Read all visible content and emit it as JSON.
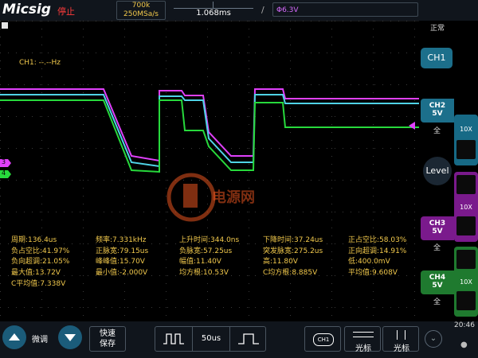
{
  "topbar": {
    "brand": "Micsig",
    "run_state": "停止",
    "memory_depth": "700k",
    "sample_rate": "250MSa/s",
    "time_position": "1.068ms",
    "trigger_edge": "/",
    "trigger_level": "Φ6.3V",
    "acquire_mode": "正常"
  },
  "scope": {
    "ch1_freq": "CH1: --.--Hz",
    "watermark_text": "电源网",
    "marker_ch3": "3",
    "marker_ch4": "4"
  },
  "measurements": {
    "col1": [
      "周期:136.4us",
      "负占空比:41.97%",
      "负向超调:21.05%",
      "最大值:13.72V",
      "C平均值:7.338V"
    ],
    "col2": [
      "频率:7.331kHz",
      "正脉宽:79.15us",
      "峰峰值:15.70V",
      "最小值:-2.000V"
    ],
    "col3": [
      "上升时间:344.0ns",
      "负脉宽:57.25us",
      "幅值:11.40V",
      "均方根:10.53V"
    ],
    "col4": [
      "下降时间:37.24us",
      "突发脉宽:275.2us",
      "高:11.80V",
      "C均方根:8.885V"
    ],
    "col5": [
      "正占空比:58.03%",
      "正向超调:14.91%",
      "低:400.0mV",
      "平均值:9.608V"
    ]
  },
  "right_panel": {
    "ch1_label": "CH1",
    "ch2_label": "CH2",
    "ch2_scale": "5V",
    "ch2_coupling": "全",
    "ch3_label": "CH3",
    "ch3_scale": "5V",
    "ch3_coupling": "全",
    "ch4_label": "CH4",
    "ch4_scale": "5V",
    "ch4_coupling": "全",
    "probe_mult": "10X",
    "level_label": "Level"
  },
  "bottombar": {
    "fine_label": "微调",
    "fast_save_line1": "快速",
    "fast_save_line2": "保存",
    "timebase": "50us",
    "channel_select": "CH1",
    "cursor_h_label": "光标",
    "cursor_v_label": "光标",
    "clock": "20:46"
  },
  "colors": {
    "ch2": "#4fd3e6",
    "ch3": "#e040fb",
    "ch4": "#27d93c",
    "accent_yellow": "#f2c94c"
  }
}
